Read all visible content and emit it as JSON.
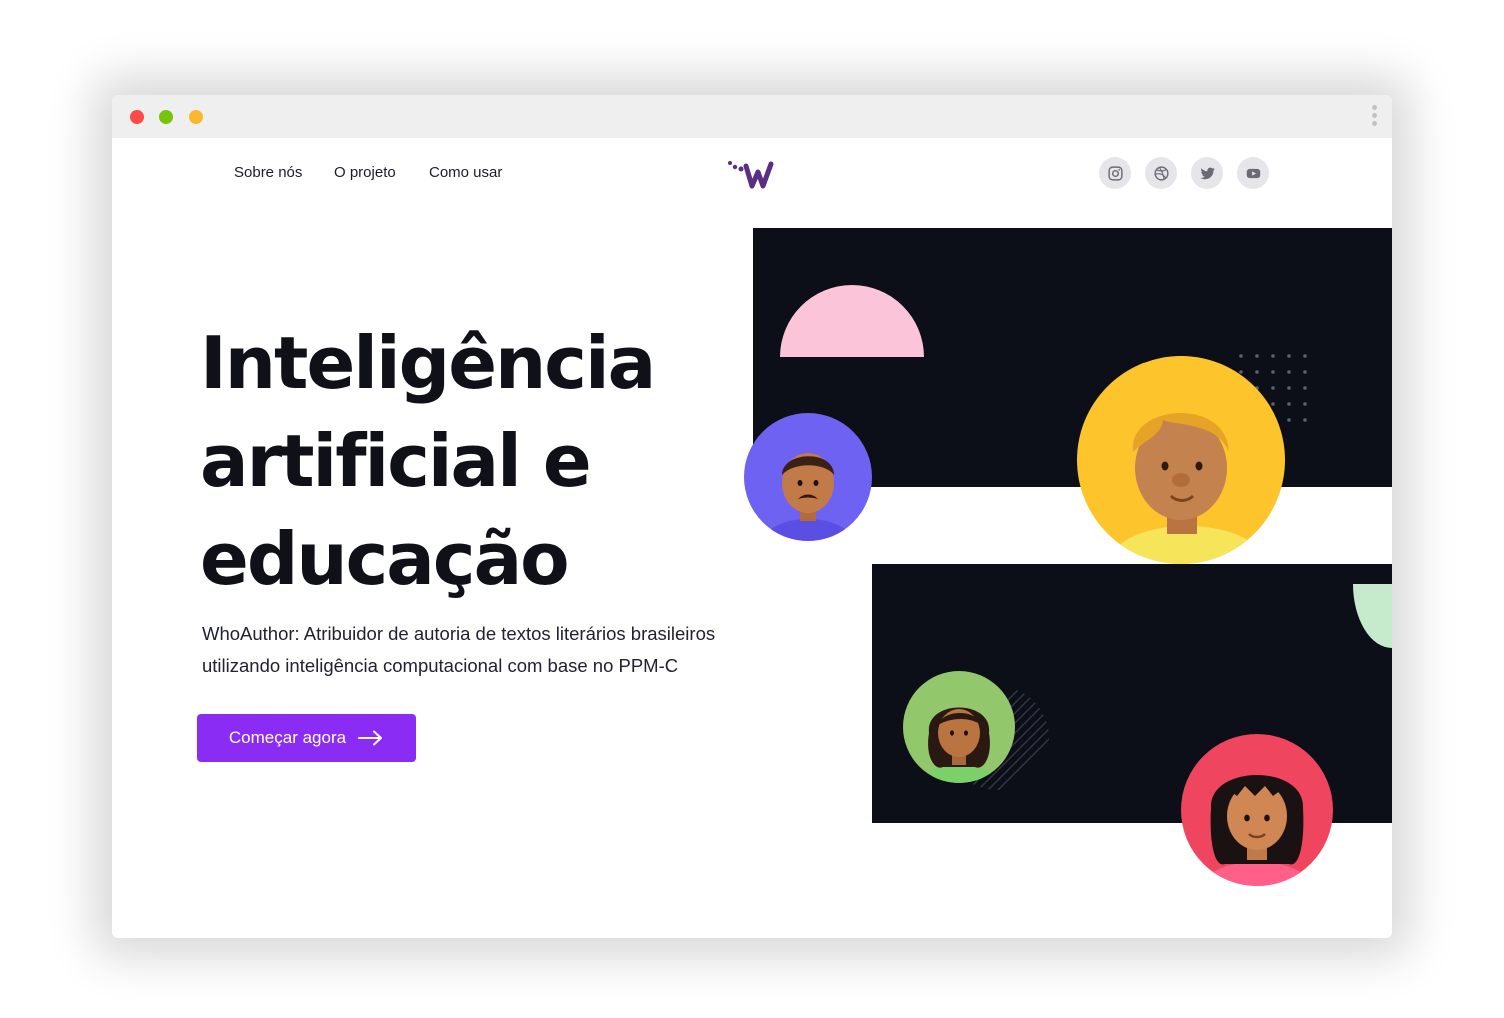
{
  "nav": {
    "links": [
      "Sobre nós",
      "O projeto",
      "Como usar"
    ]
  },
  "logo": {
    "alt": "W"
  },
  "social": [
    "instagram-icon",
    "dribbble-icon",
    "twitter-icon",
    "youtube-icon"
  ],
  "hero": {
    "title_lines": [
      "Inteligência",
      "artificial e",
      "educação"
    ],
    "subtitle_lines": [
      "WhoAuthor: Atribuidor de autoria de textos literários brasileiros",
      "utilizando inteligência computacional com base no PPM-C"
    ],
    "cta_label": "Começar agora"
  },
  "colors": {
    "accent": "#8b2cf5",
    "panel": "#0d0f18",
    "pink": "#fbc4d8",
    "mint": "#c6ebcc",
    "avatar_purple": "#6e62f2",
    "avatar_yellow": "#fdc52b",
    "avatar_green": "#93c76b",
    "avatar_red": "#f0455e"
  }
}
